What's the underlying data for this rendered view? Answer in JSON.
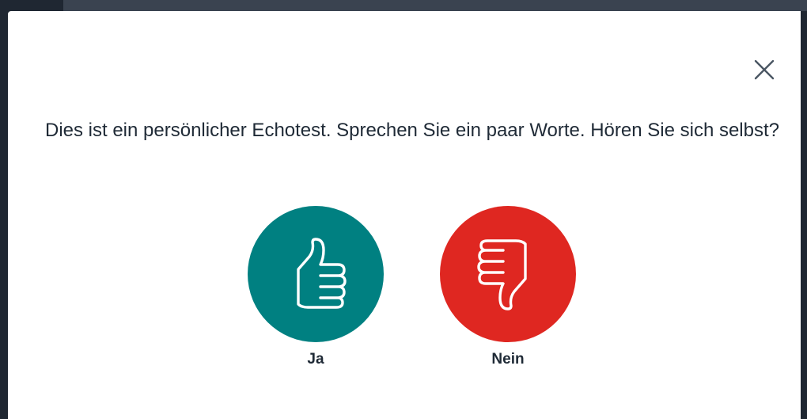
{
  "dialog": {
    "question": "Dies ist ein persönlicher Echotest. Sprechen Sie ein paar Worte. Hören Sie sich selbst?",
    "close_icon": "close-icon",
    "yes": {
      "label": "Ja",
      "icon": "thumbs-up-icon",
      "color": "#008081"
    },
    "no": {
      "label": "Nein",
      "icon": "thumbs-down-icon",
      "color": "#df2721"
    }
  }
}
